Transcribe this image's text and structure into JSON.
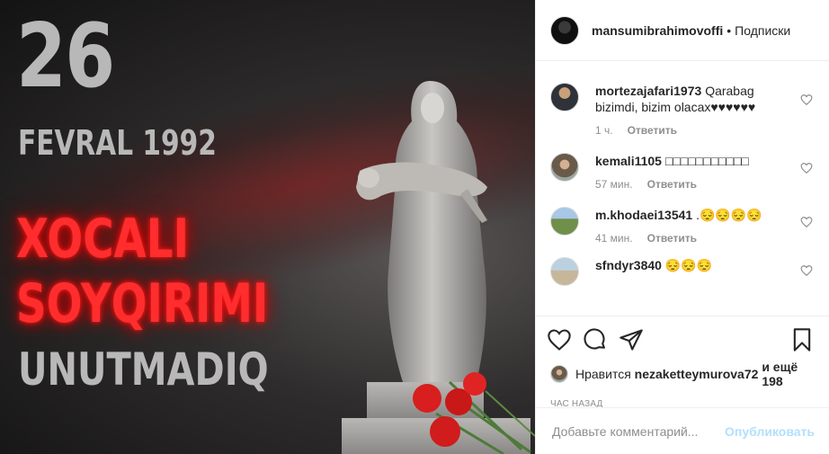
{
  "image": {
    "date_day": "26",
    "date_month_year": "FEVRAL 1992",
    "line1": "XOCALI",
    "line2": "SOYQIRIMI",
    "line3": "UNUTMADIQ",
    "accent_red": "#ff2d2d"
  },
  "header": {
    "username": "mansumibrahimovoffi",
    "separator": "•",
    "follow_label": "Подписки"
  },
  "comments": [
    {
      "user": "mortezajafari1973",
      "text": "Qarabag bizimdi, bizim olacax♥♥♥♥♥♥",
      "time": "1 ч.",
      "reply": "Ответить"
    },
    {
      "user": "kemali1105",
      "text": "□□□□□□□□□□□",
      "time": "57 мин.",
      "reply": "Ответить"
    },
    {
      "user": "m.khodaei13541",
      "text": ".😔😔😔😔",
      "time": "41 мин.",
      "reply": "Ответить"
    },
    {
      "user": "sfndyr3840",
      "text": "😔😔😔",
      "time": "",
      "reply": ""
    }
  ],
  "likes": {
    "prefix": "Нравится",
    "user": "nezaketteymurova72",
    "suffix": "и ещё 198"
  },
  "time_label": "ЧАС НАЗАД",
  "add_comment": {
    "placeholder": "Добавьте комментарий...",
    "publish_label": "Опубликовать"
  }
}
